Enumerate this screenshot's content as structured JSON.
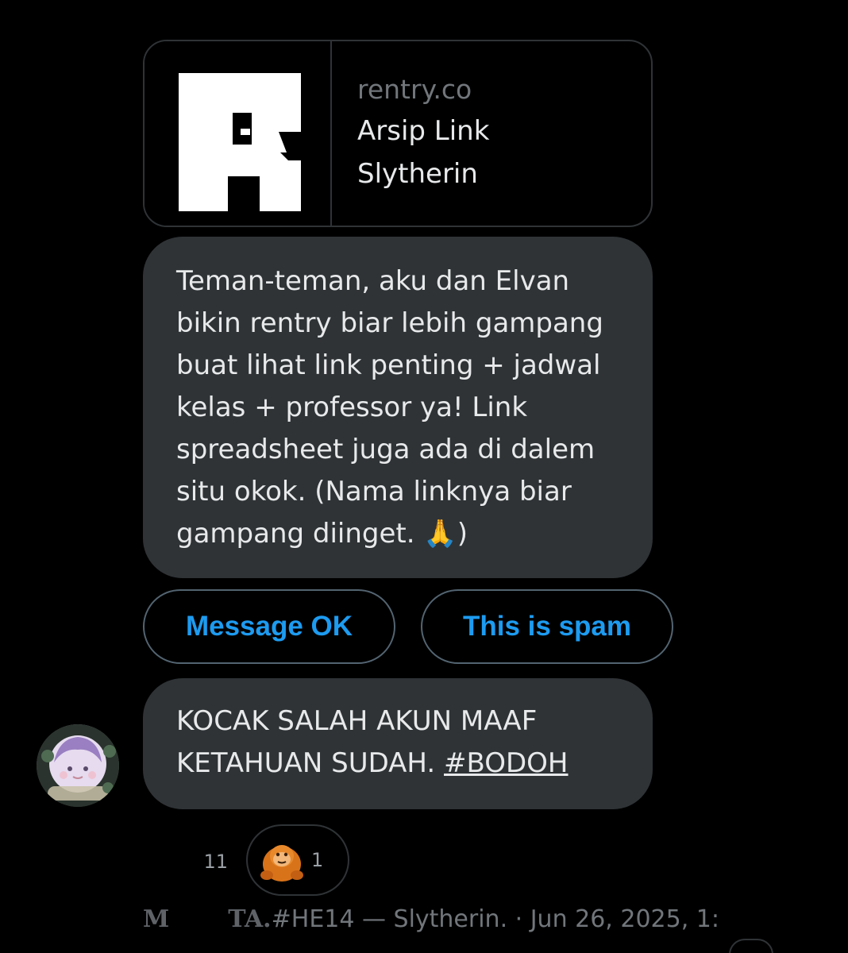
{
  "link_card": {
    "domain": "rentry.co",
    "title_line1": "Arsip Link",
    "title_line2": "Slytherin",
    "thumbnail_icon": "rentry-r-logo-icon"
  },
  "messages": [
    {
      "lines": [
        "Teman-teman, aku dan Elvan",
        "bikin rentry biar lebih gampang",
        "buat lihat link penting + jadwal",
        "kelas + professor ya! Link",
        "spreadsheet juga ada di dalem",
        "situ okok. (Nama linknya biar",
        "gampang diinget. "
      ],
      "emoji": "🙏",
      "tail": ")"
    },
    {
      "line1": "KOCAK SALAH AKUN MAAF",
      "line2_prefix": "KETAHUAN SUDAH. ",
      "hashtag": "#BODOH"
    }
  ],
  "actions": {
    "ok_label": "Message OK",
    "spam_label": "This is spam"
  },
  "avatar": {
    "icon": "profile-avatar-icon"
  },
  "reactions": [
    {
      "icon": "laughing-tears-emoji-icon",
      "emoji": "😂",
      "count": "11"
    },
    {
      "icon": "orangutan-emoji-icon",
      "count": "1"
    }
  ],
  "meta": {
    "initial": "M",
    "sender": "TA.",
    "details": " #HE14 — Slytherin. · Jun 26, 2025, 1:"
  },
  "colors": {
    "background": "#000000",
    "bubble": "#2f3336",
    "accent": "#1d9bf0",
    "text": "#e7e9ea",
    "muted": "#71767b"
  }
}
